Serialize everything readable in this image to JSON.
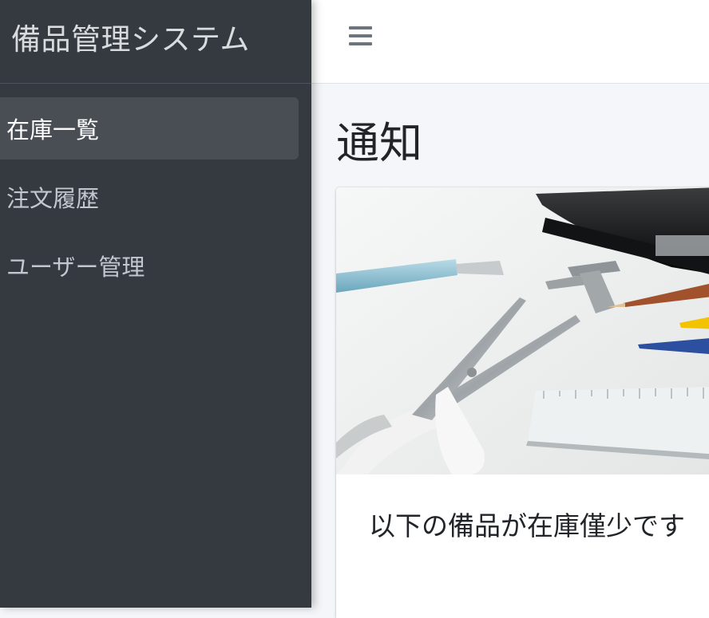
{
  "sidebar": {
    "brand": "備品管理システム",
    "items": [
      {
        "label": "在庫一覧",
        "active": true
      },
      {
        "label": "注文履歴",
        "active": false
      },
      {
        "label": "ユーザー管理",
        "active": false
      }
    ]
  },
  "topbar": {
    "menu_icon": "hamburger-icon"
  },
  "main": {
    "title": "通知",
    "card": {
      "image": "stationery-photo",
      "text": "以下の備品が在庫僅少です"
    }
  },
  "colors": {
    "sidebar_bg": "#343a40",
    "content_bg": "#f4f6f9",
    "card_bg": "#ffffff"
  }
}
